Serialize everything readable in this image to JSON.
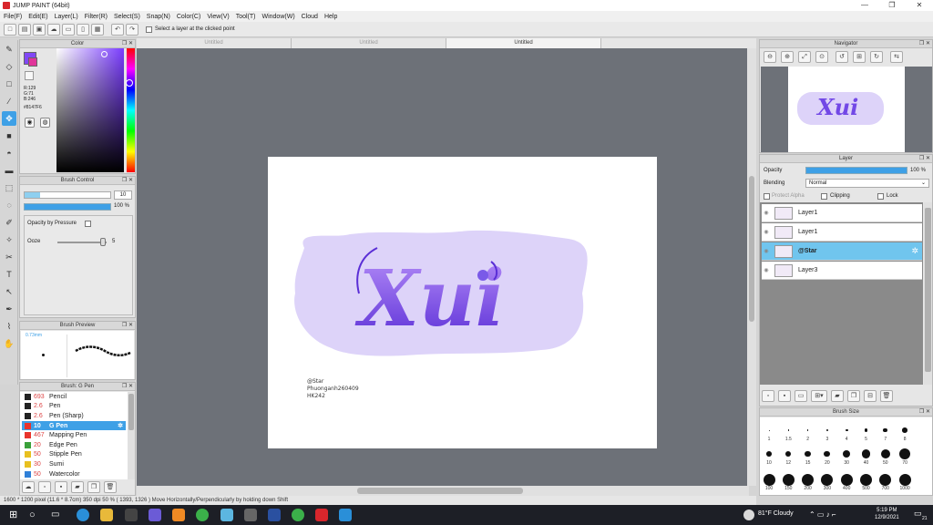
{
  "app": {
    "title": "JUMP PAINT (64bit)",
    "minimize": "—",
    "maximize": "❐",
    "close": "✕"
  },
  "menu": [
    "File(F)",
    "Edit(E)",
    "Layer(L)",
    "Filter(R)",
    "Select(S)",
    "Snap(N)",
    "Color(C)",
    "View(V)",
    "Tool(T)",
    "Window(W)",
    "Cloud",
    "Help"
  ],
  "toolbar": {
    "checkbox_label": "Select a layer at the clicked point"
  },
  "tabs": [
    "Untitled",
    "Untitled",
    "Untitled"
  ],
  "color_panel": {
    "title": "Color",
    "r": "R:129",
    "g": "G:71",
    "b": "B:246",
    "hex": "#8147F6",
    "primary": "#8147F6",
    "secondary": "#ffffff"
  },
  "brush_control": {
    "title": "Brush Control",
    "size": "10",
    "opacity": "100 %",
    "pressure_label": "Opacity by Pressure",
    "ooze_label": "Ooze",
    "ooze_value": "5"
  },
  "brush_preview": {
    "title": "Brush Preview",
    "size_label": "0.73mm"
  },
  "brush_list": {
    "title": "Brush: G Pen",
    "items": [
      {
        "size": "693",
        "name": "Pencil",
        "color": "#222222"
      },
      {
        "size": "2.6",
        "name": "Pen",
        "color": "#222222"
      },
      {
        "size": "2.6",
        "name": "Pen (Sharp)",
        "color": "#222222"
      },
      {
        "size": "10",
        "name": "G Pen",
        "color": "#e8342c",
        "selected": true
      },
      {
        "size": "467",
        "name": "Mapping Pen",
        "color": "#e8342c"
      },
      {
        "size": "20",
        "name": "Edge Pen",
        "color": "#3aa03a"
      },
      {
        "size": "50",
        "name": "Stipple Pen",
        "color": "#e8c020"
      },
      {
        "size": "30",
        "name": "Sumi",
        "color": "#e8c020"
      },
      {
        "size": "50",
        "name": "Watercolor",
        "color": "#3080d8"
      }
    ]
  },
  "artwork": {
    "main_text": "Xui",
    "credit_line1": "@Star",
    "credit_line2": "Phuonganh260409",
    "credit_line3": "HK242"
  },
  "navigator": {
    "title": "Navigator"
  },
  "layer_panel": {
    "title": "Layer",
    "opacity_label": "Opacity",
    "opacity_value": "100 %",
    "blending_label": "Blending",
    "blending_value": "Normal",
    "protect_alpha": "Protect Alpha",
    "clipping": "Clipping",
    "lock": "Lock",
    "layers": [
      {
        "name": "Layer1"
      },
      {
        "name": "Layer1"
      },
      {
        "name": "@Star",
        "selected": true
      },
      {
        "name": "Layer3"
      }
    ]
  },
  "brush_size": {
    "title": "Brush Size",
    "labels": [
      "1",
      "1.5",
      "2",
      "3",
      "4",
      "5",
      "7",
      "8",
      "10",
      "12",
      "15",
      "20",
      "30",
      "40",
      "50",
      "70",
      "100",
      "150",
      "200",
      "300",
      "400",
      "500",
      "700",
      "1000"
    ]
  },
  "status": {
    "text": "1600 * 1200 pixel   (11.6 * 8.7cm)   350 dpi   50 %   ( 1393, 1326 )   Move Horizontally/Perpendicularly by holding down Shift"
  },
  "taskbar": {
    "weather": "81°F  Cloudy",
    "time": "5:19 PM",
    "date": "12/9/2021",
    "notif": "21"
  }
}
